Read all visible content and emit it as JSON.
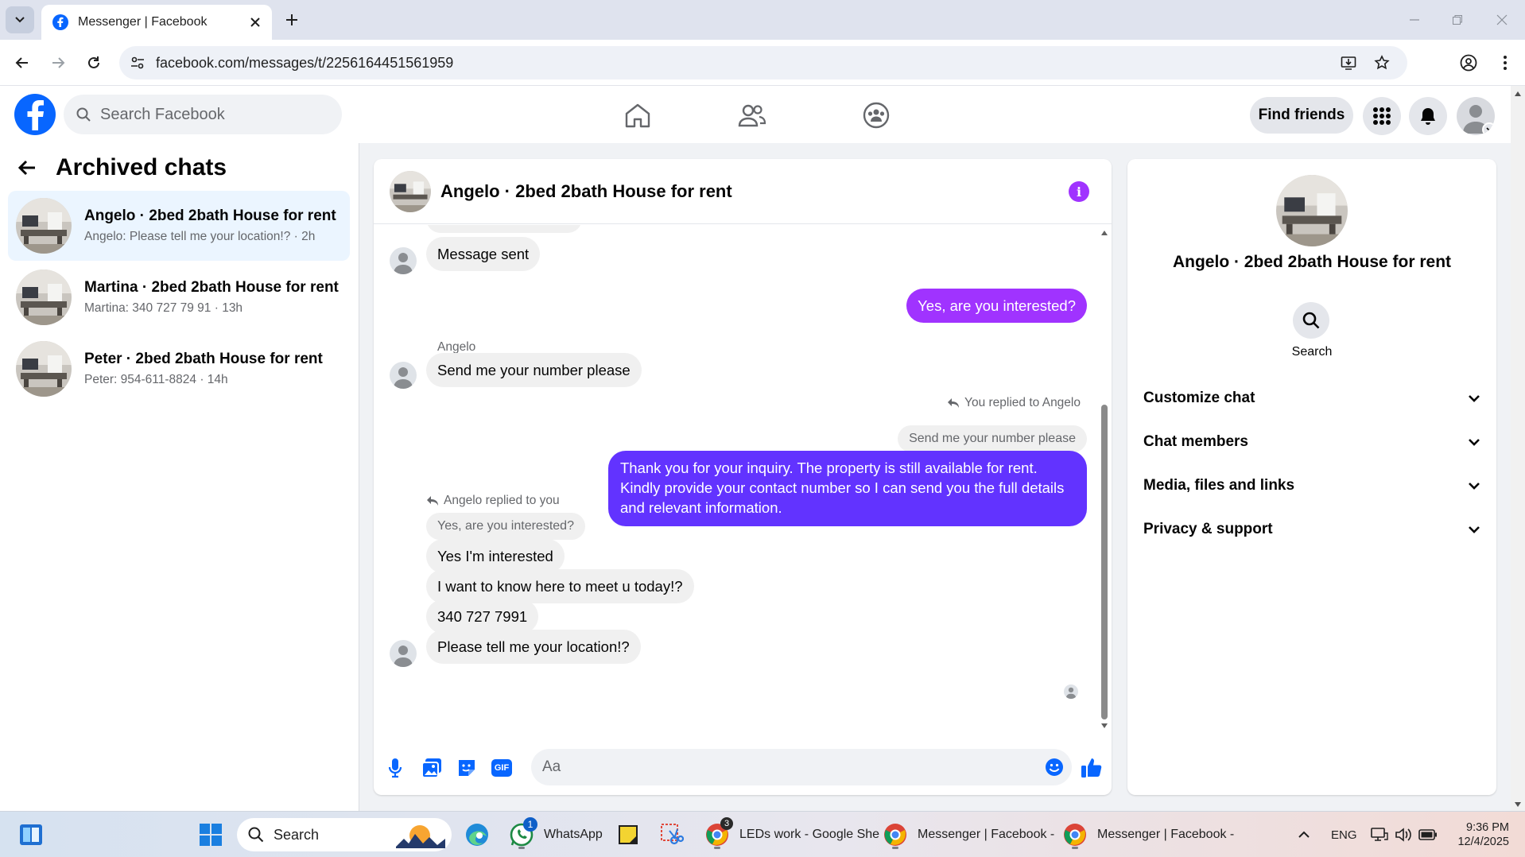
{
  "browser": {
    "tab_title": "Messenger | Facebook",
    "url": "facebook.com/messages/t/2256164451561959"
  },
  "header": {
    "search_placeholder": "Search Facebook",
    "find_friends": "Find friends"
  },
  "left": {
    "title": "Archived chats",
    "chats": [
      {
        "name": "Angelo · 2bed 2bath House for rent",
        "preview": "Angelo: Please tell me your location!? · 2h"
      },
      {
        "name": "Martina · 2bed 2bath House for rent",
        "preview": "Martina: 340 727 79 91 · 13h"
      },
      {
        "name": "Peter · 2bed 2bath House for rent",
        "preview": "Peter: 954-611-8824 · 14h"
      }
    ]
  },
  "chat": {
    "title": "Angelo · 2bed 2bath House for rent",
    "messages": {
      "m1": "Message sent",
      "m2": "Yes, are you interested?",
      "sender": "Angelo",
      "m3": "Send me your number please",
      "reply1_meta": "You replied to Angelo",
      "reply1_quote": "Send me your number please",
      "m4": "Thank you for your inquiry. The property is still available for rent. Kindly provide your contact number so I can send you the full details and relevant information.",
      "reply2_meta": "Angelo replied to you",
      "reply2_quote": "Yes, are you interested?",
      "m5": "Yes I'm interested",
      "m6": "I want to know here to meet u  today!?",
      "m7": "340 727 7991",
      "m8": "Please tell me your location!?"
    },
    "composer_placeholder": "Aa",
    "gif_label": "GIF"
  },
  "right": {
    "name": "Angelo · 2bed 2bath House for rent",
    "search_label": "Search",
    "sections": [
      "Customize chat",
      "Chat members",
      "Media, files and links",
      "Privacy & support"
    ]
  },
  "taskbar": {
    "search": "Search",
    "whatsapp": "WhatsApp",
    "whatsapp_badge": "1",
    "chrome_badge": "3",
    "app1": "LEDs work - Google She",
    "app2": "Messenger | Facebook -",
    "app3": "Messenger | Facebook -",
    "lang": "ENG",
    "time": "9:36 PM",
    "date": "12/4/2025"
  },
  "colors": {
    "fb_blue": "#0866ff",
    "outgoing_purple": "#a033ff",
    "outgoing_violet": "#6233ff"
  }
}
